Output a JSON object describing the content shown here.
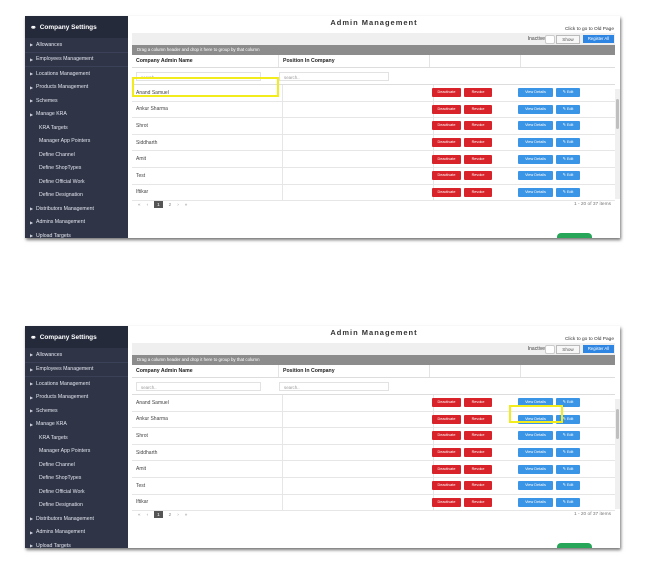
{
  "sidebar": {
    "title": "Company Settings",
    "items": [
      {
        "label": "Allowances",
        "arrow": true
      },
      {
        "label": "Employees Management",
        "arrow": true
      },
      {
        "label": "Locations Management",
        "arrow": true
      },
      {
        "label": "Products Management",
        "arrow": true
      },
      {
        "label": "Schemes",
        "arrow": true
      },
      {
        "label": "Manage KRA",
        "arrow": true
      },
      {
        "label": "KRA Targets",
        "arrow": false
      },
      {
        "label": "Manager App Pointers",
        "arrow": false
      },
      {
        "label": "Define Channel",
        "arrow": false
      },
      {
        "label": "Define ShopTypes",
        "arrow": false
      },
      {
        "label": "Define Official Work",
        "arrow": false
      },
      {
        "label": "Define Designation",
        "arrow": false
      },
      {
        "label": "Distributors Management",
        "arrow": true
      },
      {
        "label": "Admins Management",
        "arrow": true
      },
      {
        "label": "Upload Targets",
        "arrow": true
      }
    ]
  },
  "header": {
    "title": "Admin Management",
    "old_page_link": "Click to go to Old Page",
    "inactive_label": "Inactive",
    "show_button": "Show",
    "register_button": "Register All"
  },
  "grid": {
    "group_hint": "Drag a column header and drop it here to group by that column",
    "columns": [
      "Company Admin Name",
      "Position In Company"
    ],
    "filter_placeholder": "search..",
    "rows": [
      "Anand Samuel",
      "Ankur Sharma",
      "Shrot",
      "Siddharth",
      "Amit",
      "Test",
      "Iftikar"
    ],
    "actions": {
      "deactivate": "Deactivate",
      "revoke": "Revoke",
      "view": "View Details",
      "edit": "Edit"
    },
    "pager": {
      "first": "«",
      "prev": "‹",
      "pages": [
        "1",
        "2"
      ],
      "next": "›",
      "last": "»",
      "summary": "1 - 20 of 37 items"
    }
  },
  "colors": {
    "sidebar": "#2f3447",
    "accent": "#2f86e2",
    "danger": "#d8232a",
    "highlight": "#f3ec1c"
  }
}
